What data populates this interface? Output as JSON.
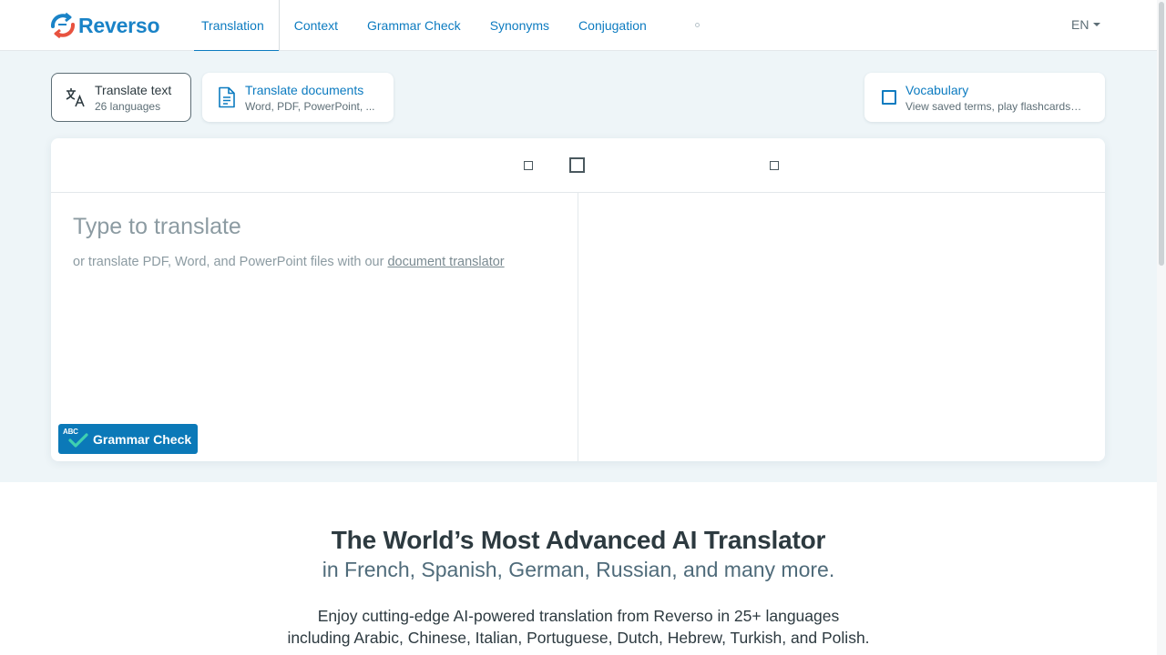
{
  "brand": {
    "name": "Reverso"
  },
  "nav": {
    "items": [
      {
        "label": "Translation",
        "active": true
      },
      {
        "label": "Context"
      },
      {
        "label": "Grammar Check"
      },
      {
        "label": "Synonyms"
      },
      {
        "label": "Conjugation"
      }
    ],
    "language": "EN"
  },
  "modes": {
    "text": {
      "title": "Translate text",
      "subtitle": "26 languages"
    },
    "documents": {
      "title": "Translate documents",
      "subtitle": "Word, PDF, PowerPoint, ..."
    },
    "vocabulary": {
      "title": "Vocabulary",
      "subtitle": "View saved terms, play flashcards…"
    }
  },
  "translator": {
    "placeholder": "Type to translate",
    "hint_prefix": "or translate PDF, Word, and PowerPoint files with our ",
    "hint_link": "document translator",
    "grammar_check": {
      "badge": "ABC",
      "label": "Grammar Check"
    }
  },
  "hero": {
    "title": "The World’s Most Advanced AI Translator",
    "subtitle": "in French, Spanish, German, Russian, and many more.",
    "description_line1": "Enjoy cutting-edge AI-powered translation from Reverso in 25+ languages",
    "description_line2": "including Arabic, Chinese, Italian, Portuguese, Dutch, Hebrew, Turkish, and Polish."
  },
  "colors": {
    "brand_blue": "#1a83c7",
    "link_blue": "#0c7bc0",
    "accent_red": "#e8523f",
    "section_bg": "#eef5f8",
    "grammar_button": "#0b79b8",
    "check_green": "#3fd0b0"
  },
  "icons": {
    "logo": "reverso-logo-icon",
    "translate_text": "translate-icon",
    "documents": "document-icon",
    "vocabulary": "bookmark-square-icon",
    "grammar": "abc-check-icon",
    "language_caret": "chevron-down-icon"
  }
}
